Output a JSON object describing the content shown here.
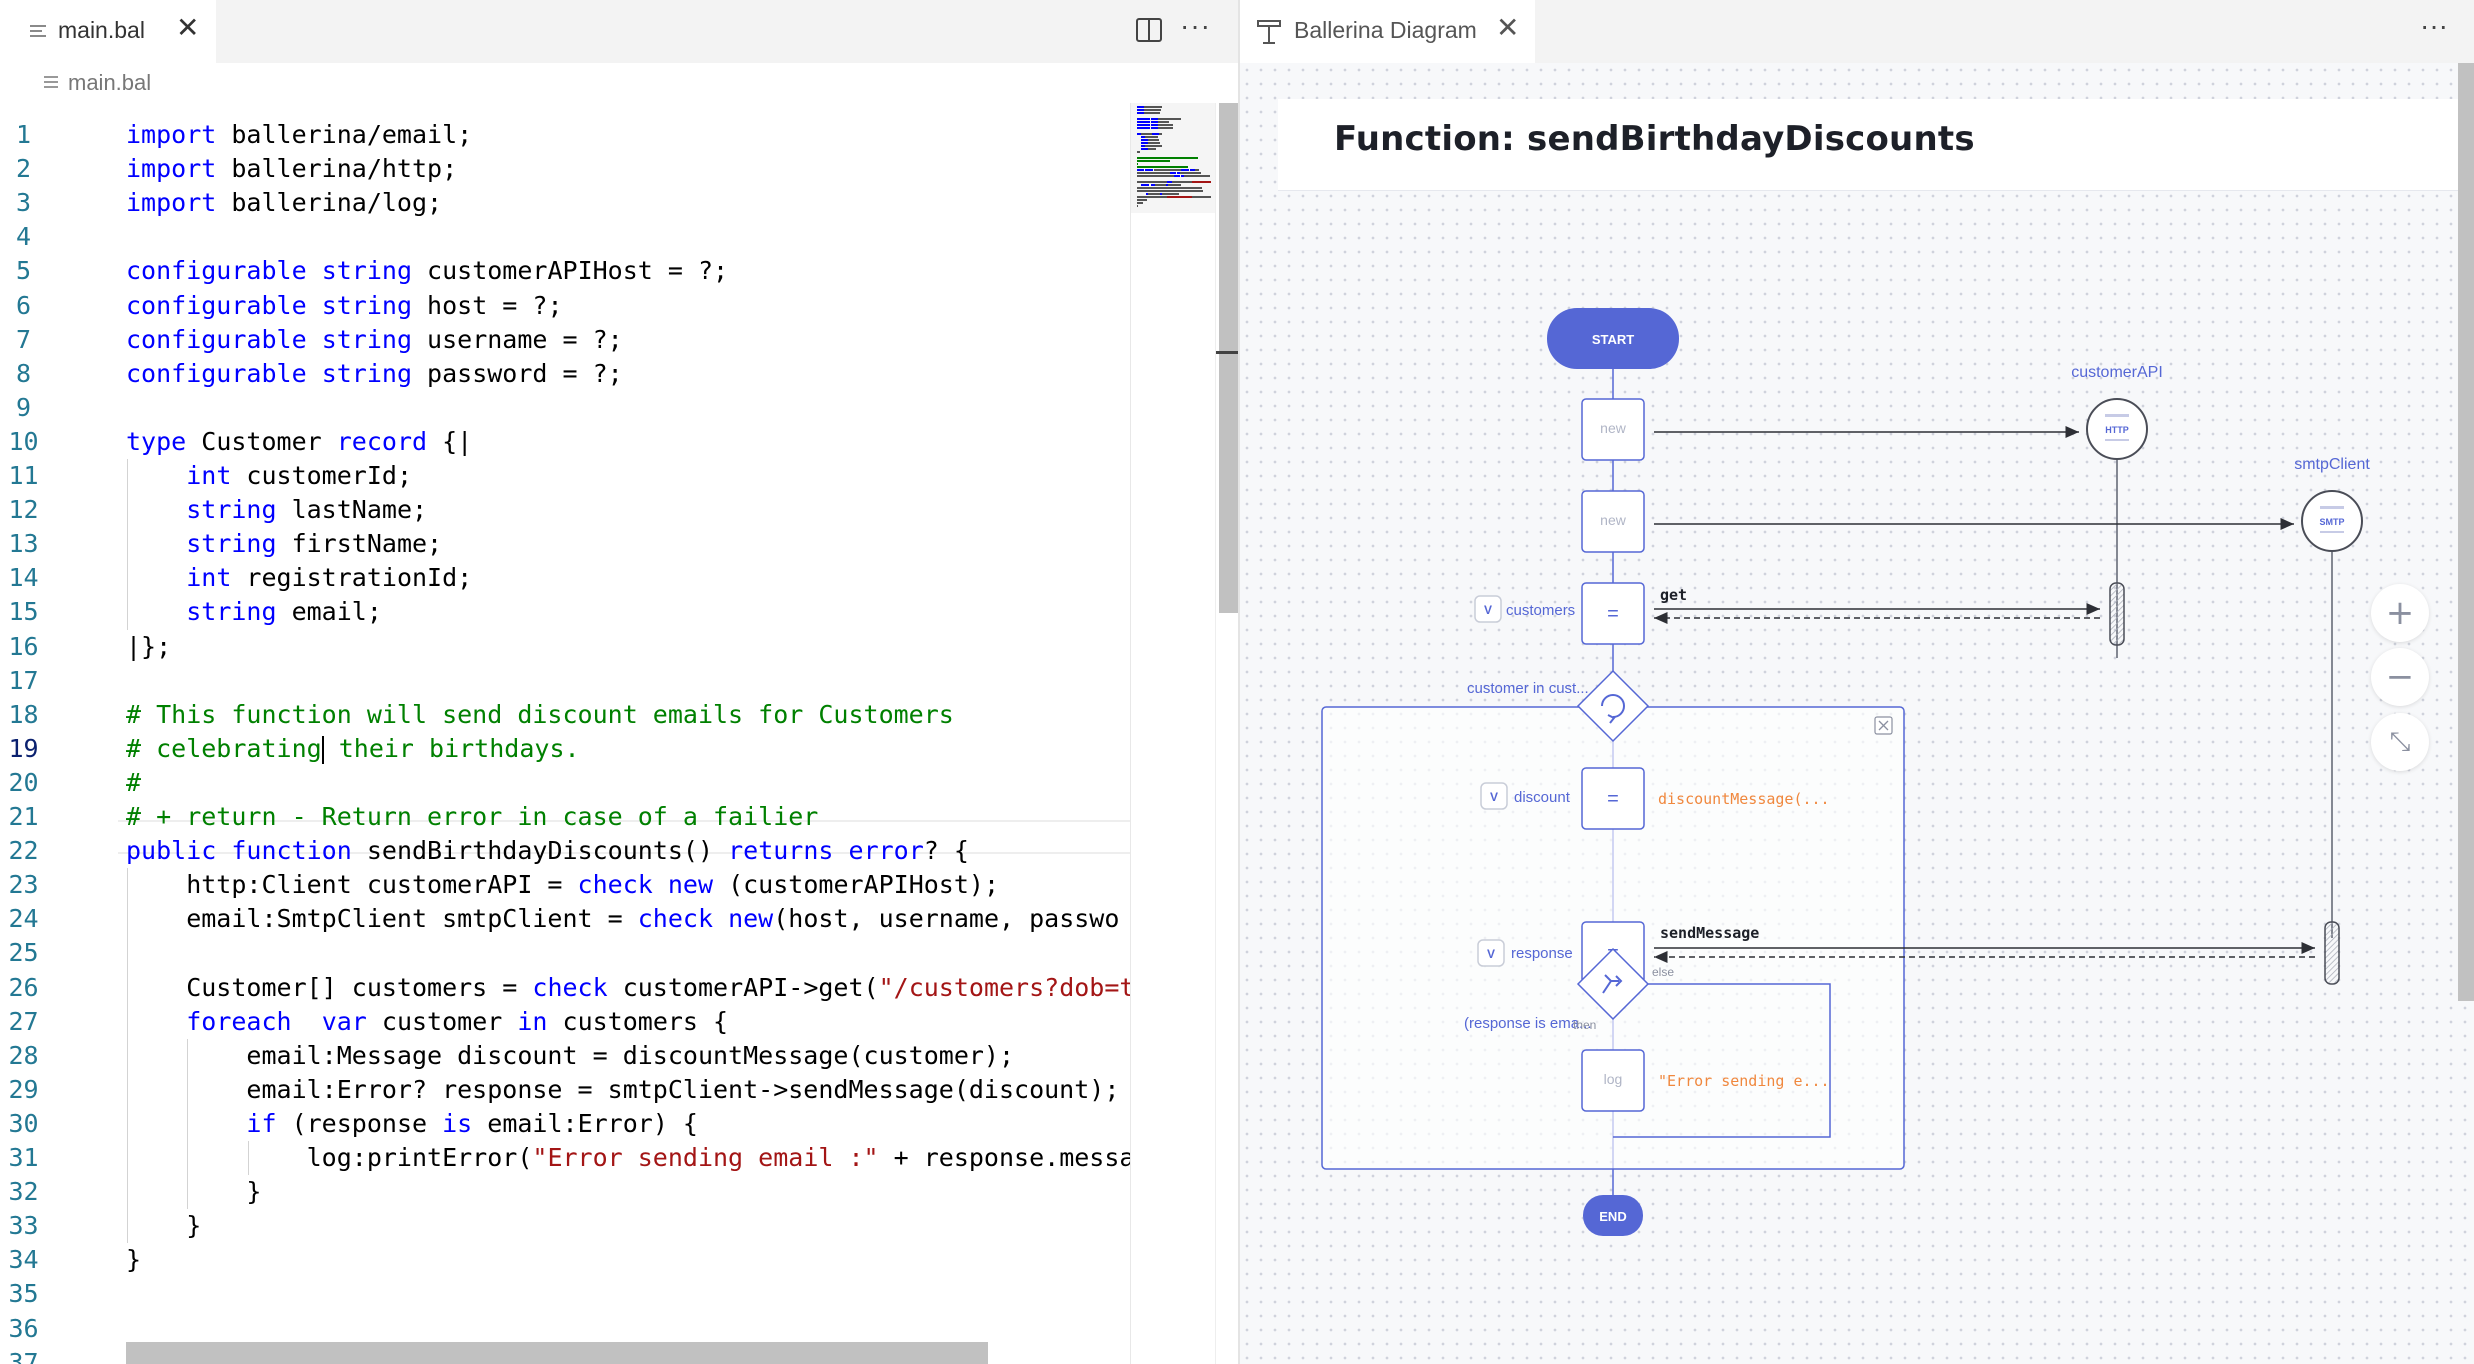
{
  "editor": {
    "tab_label": "main.bal",
    "tab_close": "✕",
    "more_actions": "···",
    "breadcrumb": "main.bal",
    "active_line": 19,
    "lines": [
      [
        [
          "kw",
          "import"
        ],
        [
          "plain",
          " ballerina/email;"
        ]
      ],
      [
        [
          "kw",
          "import"
        ],
        [
          "plain",
          " ballerina/http;"
        ]
      ],
      [
        [
          "kw",
          "import"
        ],
        [
          "plain",
          " ballerina/log;"
        ]
      ],
      [],
      [
        [
          "kw",
          "configurable"
        ],
        [
          "plain",
          " "
        ],
        [
          "kw",
          "string"
        ],
        [
          "plain",
          " customerAPIHost = ?;"
        ]
      ],
      [
        [
          "kw",
          "configurable"
        ],
        [
          "plain",
          " "
        ],
        [
          "kw",
          "string"
        ],
        [
          "plain",
          " host = ?;"
        ]
      ],
      [
        [
          "kw",
          "configurable"
        ],
        [
          "plain",
          " "
        ],
        [
          "kw",
          "string"
        ],
        [
          "plain",
          " username = ?;"
        ]
      ],
      [
        [
          "kw",
          "configurable"
        ],
        [
          "plain",
          " "
        ],
        [
          "kw",
          "string"
        ],
        [
          "plain",
          " password = ?;"
        ]
      ],
      [],
      [
        [
          "kw",
          "type"
        ],
        [
          "plain",
          " Customer "
        ],
        [
          "kw",
          "record"
        ],
        [
          "plain",
          " {|"
        ]
      ],
      [
        [
          "plain",
          "    "
        ],
        [
          "kw",
          "int"
        ],
        [
          "plain",
          " customerId;"
        ]
      ],
      [
        [
          "plain",
          "    "
        ],
        [
          "kw",
          "string"
        ],
        [
          "plain",
          " lastName;"
        ]
      ],
      [
        [
          "plain",
          "    "
        ],
        [
          "kw",
          "string"
        ],
        [
          "plain",
          " firstName;"
        ]
      ],
      [
        [
          "plain",
          "    "
        ],
        [
          "kw",
          "int"
        ],
        [
          "plain",
          " registrationId;"
        ]
      ],
      [
        [
          "plain",
          "    "
        ],
        [
          "kw",
          "string"
        ],
        [
          "plain",
          " email;"
        ]
      ],
      [
        [
          "plain",
          "|};"
        ]
      ],
      [],
      [
        [
          "cm",
          "# This function will send discount emails for Customers"
        ]
      ],
      [
        [
          "cm",
          "# celebrating"
        ],
        [
          "cursor",
          ""
        ],
        [
          "cm",
          " their birthdays."
        ]
      ],
      [
        [
          "cm",
          "#"
        ]
      ],
      [
        [
          "cm",
          "# + return - Return error in case of a failier"
        ]
      ],
      [
        [
          "kw",
          "public"
        ],
        [
          "plain",
          " "
        ],
        [
          "kw",
          "function"
        ],
        [
          "plain",
          " sendBirthdayDiscounts() "
        ],
        [
          "kw",
          "returns"
        ],
        [
          "plain",
          " "
        ],
        [
          "kw",
          "error"
        ],
        [
          "plain",
          "? {"
        ]
      ],
      [
        [
          "plain",
          "    http:Client customerAPI = "
        ],
        [
          "kw",
          "check"
        ],
        [
          "plain",
          " "
        ],
        [
          "kw",
          "new"
        ],
        [
          "plain",
          " (customerAPIHost);"
        ]
      ],
      [
        [
          "plain",
          "    email:SmtpClient smtpClient = "
        ],
        [
          "kw",
          "check"
        ],
        [
          "plain",
          " "
        ],
        [
          "kw",
          "new"
        ],
        [
          "plain",
          "(host, username, passwo"
        ]
      ],
      [],
      [
        [
          "plain",
          "    Customer[] customers = "
        ],
        [
          "kw",
          "check"
        ],
        [
          "plain",
          " customerAPI->get("
        ],
        [
          "str",
          "\"/customers?dob=t"
        ]
      ],
      [
        [
          "plain",
          "    "
        ],
        [
          "kw",
          "foreach"
        ],
        [
          "plain",
          "  "
        ],
        [
          "kw",
          "var"
        ],
        [
          "plain",
          " customer "
        ],
        [
          "kw",
          "in"
        ],
        [
          "plain",
          " customers {"
        ]
      ],
      [
        [
          "plain",
          "        email:Message discount = discountMessage(customer);"
        ]
      ],
      [
        [
          "plain",
          "        email:Error? response = smtpClient->sendMessage(discount);"
        ]
      ],
      [
        [
          "plain",
          "        "
        ],
        [
          "kw",
          "if"
        ],
        [
          "plain",
          " (response "
        ],
        [
          "kw",
          "is"
        ],
        [
          "plain",
          " email:Error) {"
        ]
      ],
      [
        [
          "plain",
          "            log:printError("
        ],
        [
          "str",
          "\"Error sending email :\""
        ],
        [
          "plain",
          " + response.messa"
        ]
      ],
      [
        [
          "plain",
          "        }"
        ]
      ],
      [
        [
          "plain",
          "    }"
        ]
      ],
      [
        [
          "plain",
          "}"
        ]
      ],
      [],
      [],
      []
    ]
  },
  "diagram": {
    "tab_label": "Ballerina Diagram",
    "tab_close": "✕",
    "more_actions": "···",
    "title": "Function: sendBirthdayDiscounts",
    "start_label": "START",
    "end_label": "END",
    "new_label_1": "new",
    "new_label_2": "new",
    "endpoint_customer_api": "customerAPI",
    "endpoint_customer_api_badge": "HTTP",
    "endpoint_smtp": "smtpClient",
    "endpoint_smtp_badge": "SMTP",
    "customers_var": "customers",
    "assign_symbol": "=",
    "get_action": "get",
    "foreach_label": "customer in cust...",
    "discount_var": "discount",
    "discount_expr": "discountMessage(...",
    "response_var": "response",
    "send_action": "sendMessage",
    "if_label": "(response is ema...",
    "else_label": "else",
    "then_label": "then",
    "log_label": "log",
    "log_expr": "\"Error sending e...",
    "var_badge": "V",
    "zoom_in": "+",
    "zoom_out": "−",
    "fit": "⤡"
  },
  "colors": {
    "keyword": "#0000ff",
    "comment": "#008000",
    "string": "#a31515",
    "line_number": "#237893",
    "diagram_accent": "#5567d5",
    "expression_orange": "#f0883e"
  }
}
